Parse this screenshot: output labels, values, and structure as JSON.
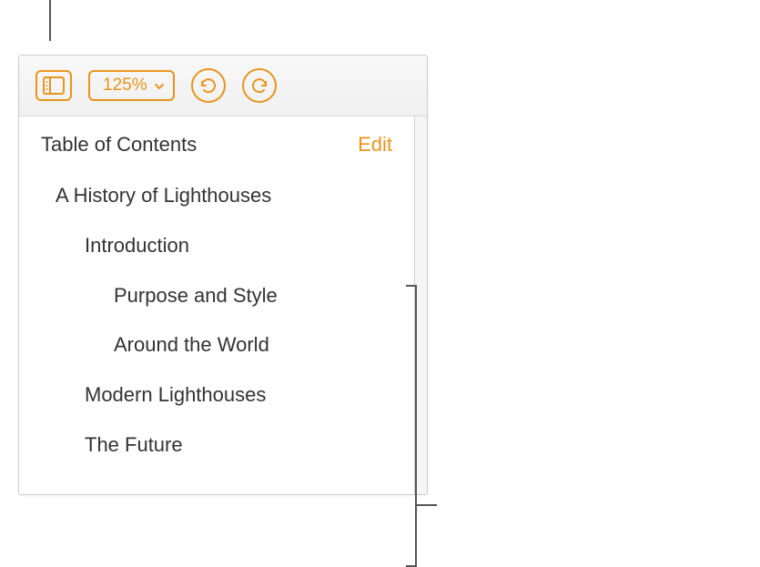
{
  "toolbar": {
    "zoom_level": "125%"
  },
  "sidebar": {
    "title": "Table of Contents",
    "edit_label": "Edit",
    "items": [
      {
        "label": "A History of Lighthouses",
        "level": 0
      },
      {
        "label": "Introduction",
        "level": 1
      },
      {
        "label": "Purpose and Style",
        "level": 2
      },
      {
        "label": "Around the World",
        "level": 2
      },
      {
        "label": "Modern Lighthouses",
        "level": 1
      },
      {
        "label": "The Future",
        "level": 1
      }
    ]
  }
}
